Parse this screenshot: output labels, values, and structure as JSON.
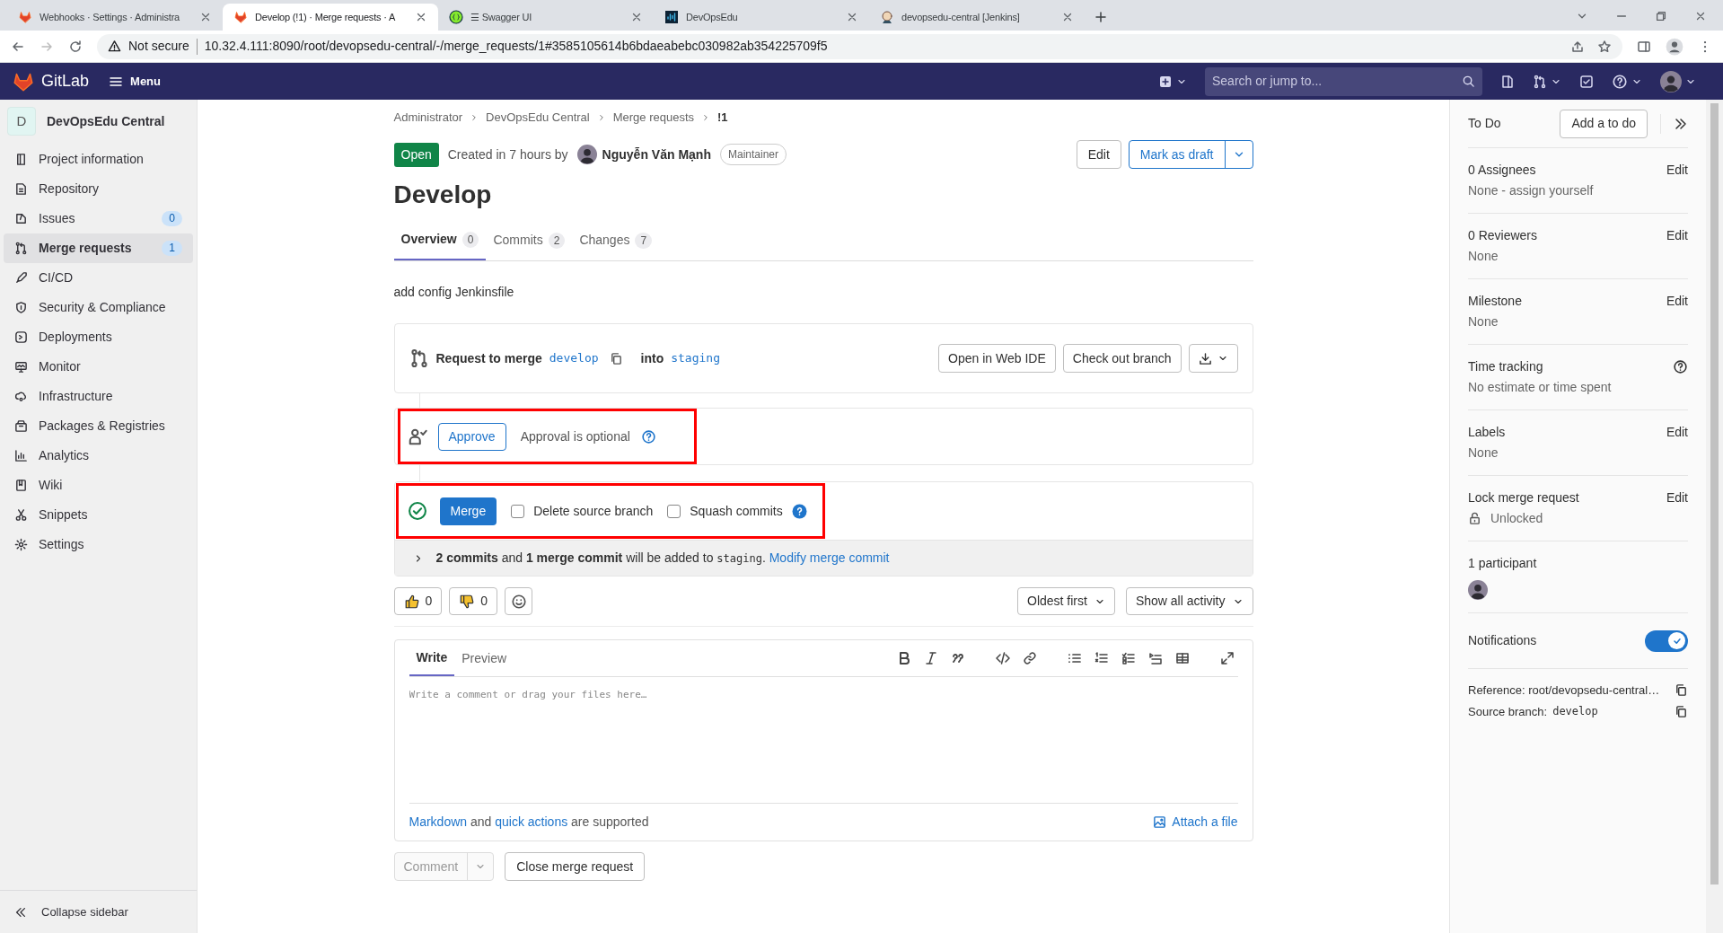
{
  "browser": {
    "tabs": [
      {
        "title": "Webhooks · Settings · Administra",
        "selected": false,
        "kind": "gitlab"
      },
      {
        "title": "Develop (!1) · Merge requests · A",
        "selected": true,
        "kind": "gitlab"
      },
      {
        "title": "☰ Swagger UI",
        "selected": false,
        "kind": "swagger"
      },
      {
        "title": "DevOpsEdu",
        "selected": false,
        "kind": "wave"
      },
      {
        "title": "devopsedu-central [Jenkins]",
        "selected": false,
        "kind": "person"
      }
    ],
    "security": "Not secure",
    "url": "10.32.4.111:8090/root/devopsedu-central/-/merge_requests/1#3585105614b6bdaeabebc030982ab354225709f5"
  },
  "header": {
    "logo": "GitLab",
    "menu": "Menu",
    "search_placeholder": "Search or jump to..."
  },
  "sidebar": {
    "project_initial": "D",
    "project_name": "DevOpsEdu Central",
    "items": [
      {
        "label": "Project information",
        "selected": false
      },
      {
        "label": "Repository",
        "selected": false
      },
      {
        "label": "Issues",
        "count": "0",
        "selected": false
      },
      {
        "label": "Merge requests",
        "count": "1",
        "selected": true
      },
      {
        "label": "CI/CD",
        "selected": false
      },
      {
        "label": "Security & Compliance",
        "selected": false
      },
      {
        "label": "Deployments",
        "selected": false
      },
      {
        "label": "Monitor",
        "selected": false
      },
      {
        "label": "Infrastructure",
        "selected": false
      },
      {
        "label": "Packages & Registries",
        "selected": false
      },
      {
        "label": "Analytics",
        "selected": false
      },
      {
        "label": "Wiki",
        "selected": false
      },
      {
        "label": "Snippets",
        "selected": false
      },
      {
        "label": "Settings",
        "selected": false
      }
    ],
    "collapse": "Collapse sidebar"
  },
  "breadcrumbs": [
    "Administrator",
    "DevOpsEdu Central",
    "Merge requests",
    "!1"
  ],
  "merge_request": {
    "status": "Open",
    "created": "Created in 7 hours by",
    "author": "Nguyễn Văn Mạnh",
    "role": "Maintainer",
    "edit": "Edit",
    "mark_as_draft": "Mark as draft",
    "title": "Develop",
    "tabs": [
      {
        "label": "Overview",
        "count": "0",
        "selected": true
      },
      {
        "label": "Commits",
        "count": "2",
        "selected": false
      },
      {
        "label": "Changes",
        "count": "7",
        "selected": false
      }
    ],
    "description": "add config Jenkinsfile"
  },
  "widget": {
    "request": "Request to merge",
    "source": "develop",
    "into": "into",
    "target": "staging",
    "buttons": [
      "Open in Web IDE",
      "Check out branch"
    ]
  },
  "approval": {
    "button": "Approve",
    "text": "Approval is optional"
  },
  "merge": {
    "button": "Merge",
    "options": [
      {
        "label": "Delete source branch",
        "checked": false,
        "help": false
      },
      {
        "label": "Squash commits",
        "checked": false,
        "help": true
      }
    ]
  },
  "commit_message": {
    "text": "**2 commits** and **1 merge commit** will be added to",
    "branch": "staging",
    "end": ".",
    "link": "Modify merge commit"
  },
  "reactions": [
    {
      "kind": "thumbs_up",
      "count": "0"
    },
    {
      "kind": "thumbs_down",
      "count": "0"
    }
  ],
  "filters": [
    "Oldest first",
    "Show all activity"
  ],
  "editor": {
    "tabs": [
      {
        "label": "Write",
        "selected": true
      },
      {
        "label": "Preview",
        "selected": false
      }
    ],
    "placeholder": "Write a comment or drag your files here…",
    "links": [
      "Markdown",
      "quick actions"
    ],
    "joiner": "and",
    "tail": "are supported",
    "attach": "Attach a file"
  },
  "actions": {
    "comment": "Comment",
    "comment_disabled": true,
    "close": "Close merge request"
  },
  "right_sidebar": {
    "todo_label": "To Do",
    "todo_button": "Add a to do",
    "sections": [
      {
        "kind": "edit",
        "title": "0 Assignees",
        "value": "None - assign yourself",
        "action": "Edit"
      },
      {
        "kind": "edit",
        "title": "0 Reviewers",
        "value": "None",
        "action": "Edit"
      },
      {
        "kind": "edit",
        "title": "Milestone",
        "value": "None",
        "action": "Edit"
      },
      {
        "kind": "help",
        "title": "Time tracking",
        "value": "No estimate or time spent"
      },
      {
        "kind": "edit",
        "title": "Labels",
        "value": "None",
        "action": "Edit"
      },
      {
        "kind": "lock",
        "title": "Lock merge request",
        "value": "Unlocked",
        "action": "Edit"
      }
    ],
    "participants": "1 participant",
    "notifications": {
      "label": "Notifications",
      "on": true
    },
    "reference": "Reference: root/devopsedu-central…",
    "source_label": "Source branch:",
    "source_branch": "develop"
  }
}
